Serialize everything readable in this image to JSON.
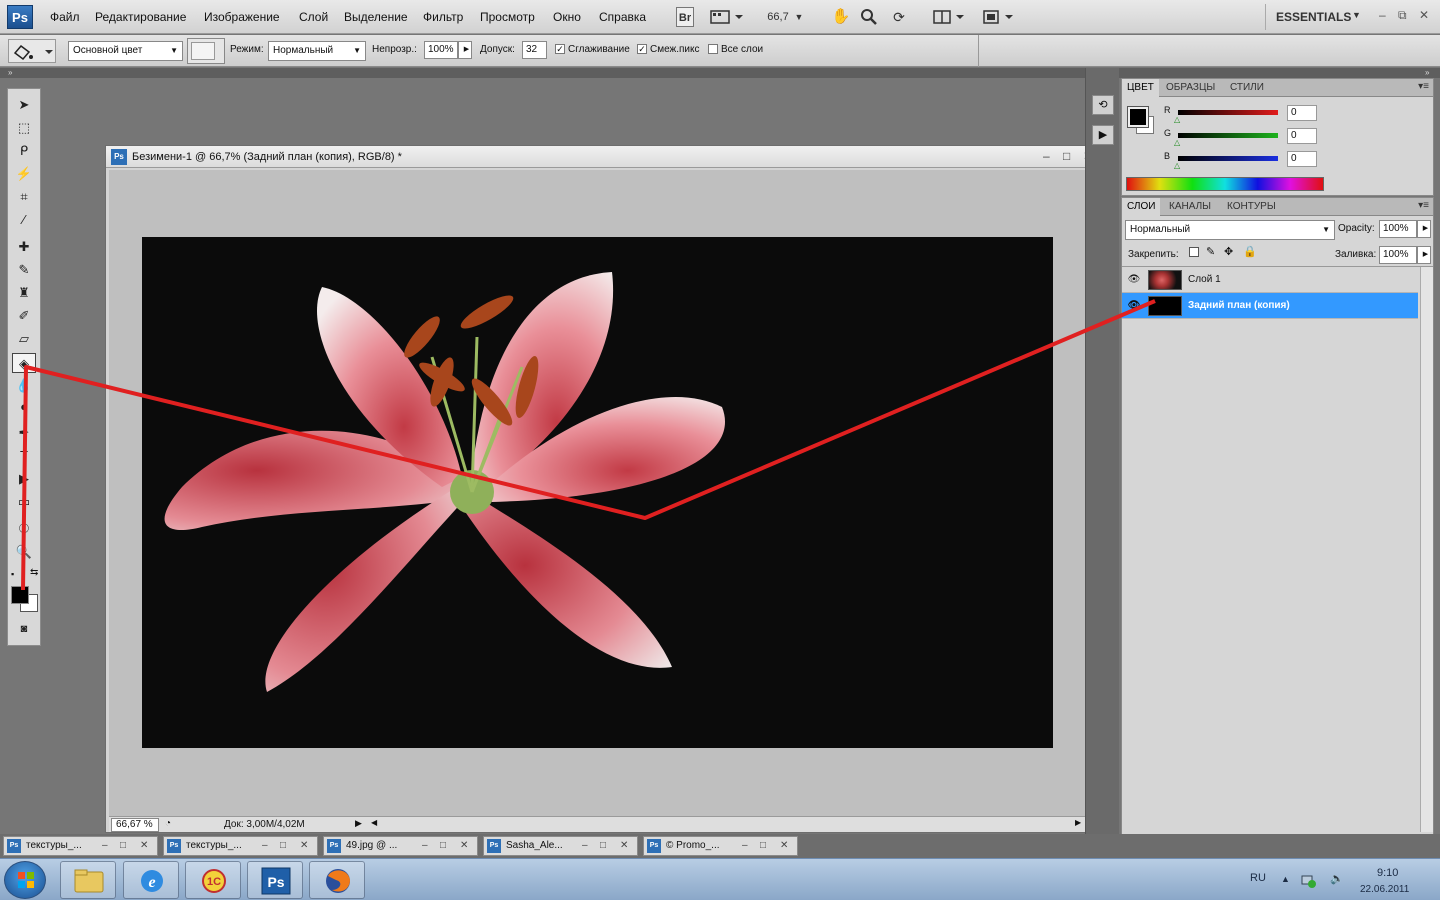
{
  "app": {
    "logo": "Ps",
    "menu": [
      "Файл",
      "Редактирование",
      "Изображение",
      "Слой",
      "Выделение",
      "Фильтр",
      "Просмотр",
      "Окно",
      "Справка"
    ],
    "bridge_label": "Br",
    "zoom_value": "66,7",
    "workspace": "ESSENTIALS",
    "window_controls": [
      "–",
      "⧉",
      "✕"
    ]
  },
  "options_bar": {
    "fill_source": "Основной цвет",
    "mode_label": "Режим:",
    "mode_value": "Нормальный",
    "opacity_label": "Непрозр.:",
    "opacity_value": "100%",
    "tolerance_label": "Допуск:",
    "tolerance_value": "32",
    "antialias_label": "Сглаживание",
    "antialias_checked": true,
    "contiguous_label": "Смеж.пикс",
    "contiguous_checked": true,
    "all_layers_label": "Все слои",
    "all_layers_checked": false
  },
  "document": {
    "title": "Безимени-1 @ 66,7% (Задний план (копия), RGB/8) *",
    "zoom": "66,67 %",
    "doc_info": "Док: 3,00M/4,02M"
  },
  "color_panel": {
    "tabs": [
      "ЦВЕТ",
      "ОБРАЗЦЫ",
      "СТИЛИ"
    ],
    "channels": [
      {
        "label": "R",
        "value": "0",
        "color": "#e11b1b"
      },
      {
        "label": "G",
        "value": "0",
        "color": "#1db31d"
      },
      {
        "label": "B",
        "value": "0",
        "color": "#1b2fe1"
      }
    ]
  },
  "layers_panel": {
    "tabs": [
      "СЛОИ",
      "КАНАЛЫ",
      "КОНТУРЫ"
    ],
    "blend_mode": "Нормальный",
    "opacity_label": "Opacity:",
    "opacity_value": "100%",
    "lock_label": "Закрепить:",
    "fill_label": "Заливка:",
    "fill_value": "100%",
    "layers": [
      {
        "name": "Слой 1",
        "selected": false
      },
      {
        "name": "Задний план (копия)",
        "selected": true
      }
    ]
  },
  "minimized_docs": [
    "текстуры_...",
    "текстуры_...",
    "49.jpg @ ...",
    "Sasha_Ale...",
    "© Promo_..."
  ],
  "taskbar": {
    "language": "RU",
    "time": "9:10",
    "date": "22.06.2011",
    "apps": [
      "explorer-icon",
      "ie-icon",
      "1c-icon",
      "photoshop-icon",
      "firefox-icon"
    ]
  },
  "colors": {
    "selection_blue": "#3399ff",
    "annotation_red": "#e02020",
    "foreground": "#000000",
    "background": "#ffffff"
  }
}
